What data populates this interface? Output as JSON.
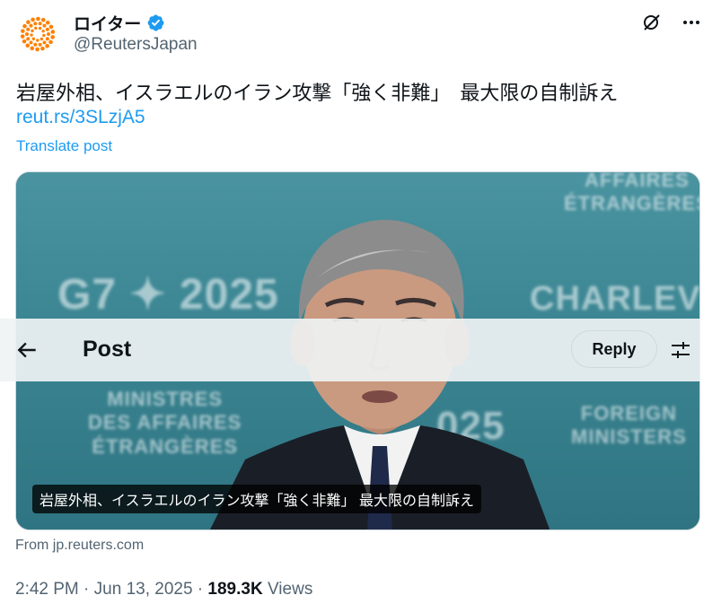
{
  "account": {
    "display_name": "ロイター",
    "handle": "@ReutersJapan",
    "verified": true,
    "brand_color": "#ff8000",
    "verified_color": "#1d9bf0"
  },
  "post": {
    "text": "岩屋外相、イスラエルのイラン攻撃「強く非難」　最大限の自制訴え",
    "link": "reut.rs/3SLzjA5",
    "translate_label": "Translate post",
    "media_caption": "岩屋外相、イスラエルのイラン攻撃「強く非難」 最大限の自制訴え",
    "source_label": "From jp.reuters.com",
    "time": "2:42 PM",
    "date": "Jun 13, 2025",
    "separator": " · ",
    "views_count": "189.3K",
    "views_label": " Views"
  },
  "photo_backdrop": {
    "left_text": "G7 ✦ 2025",
    "left_lower": "MINISTRES\nDES AFFAIRES\nÉTRANGÈRES",
    "right_text": "CHARLEVOIX",
    "right_upper": "AFFAIRES\nÉTRANGÈRES",
    "right_lower": "FOREIGN\nMINISTERS",
    "middle_number": "025"
  },
  "overlay_header": {
    "title": "Post",
    "reply_label": "Reply"
  },
  "icons": {
    "avatar": "reuters-logo-icon",
    "verified": "verified-badge-icon",
    "grok": "grok-icon",
    "more": "more-icon",
    "back": "back-arrow-icon",
    "settings": "settings-sliders-icon"
  }
}
